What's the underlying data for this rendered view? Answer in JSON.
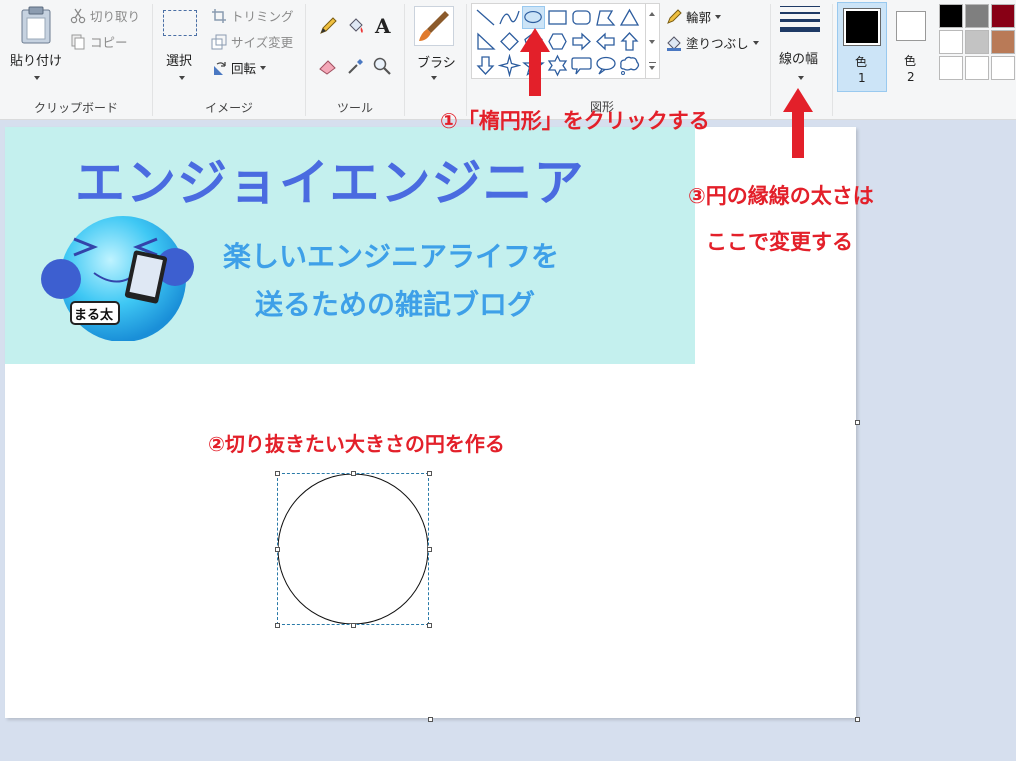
{
  "ribbon": {
    "clipboard": {
      "paste_label": "貼り付け",
      "cut_label": "切り取り",
      "copy_label": "コピー",
      "group_label": "クリップボード"
    },
    "image": {
      "select_label": "選択",
      "crop_label": "トリミング",
      "resize_label": "サイズ変更",
      "rotate_label": "回転",
      "group_label": "イメージ"
    },
    "tools": {
      "group_label": "ツール"
    },
    "brush": {
      "label": "ブラシ"
    },
    "shapes": {
      "outline_label": "輪郭",
      "fill_label": "塗りつぶし",
      "group_label": "図形",
      "selected": "oval-shape",
      "items": [
        "line",
        "curve",
        "oval",
        "rectangle",
        "rounded-rectangle",
        "polygon",
        "triangle",
        "right-triangle",
        "diamond",
        "pentagon",
        "hexagon",
        "right-arrow",
        "left-arrow",
        "up-arrow",
        "down-arrow",
        "four-point-star",
        "five-point-star",
        "six-point-star",
        "rounded-callout",
        "oval-callout",
        "cloud-callout"
      ]
    },
    "size": {
      "label": "線の幅"
    },
    "colors": {
      "color1_label": "色",
      "color1_num": "1",
      "color2_label": "色",
      "color2_num": "2",
      "color1": "#000000",
      "color2": "#ffffff",
      "palette_row1": [
        "#000000",
        "#7f7f7f",
        "#880015"
      ],
      "palette_row2": [
        "#ffffff",
        "#c3c3c3",
        "#b97a57"
      ],
      "palette_row3": [
        "#ffffff",
        "#ffffff",
        "#ffffff"
      ]
    }
  },
  "canvas": {
    "banner": {
      "title": "エンジョイエンジニア",
      "subtitle_line1": "楽しいエンジニアライフを",
      "subtitle_line2": "送るための雑記ブログ",
      "mascot_tag": "まる太"
    }
  },
  "annotations": {
    "step1": "①「楕円形」をクリックする",
    "step2": "②切り抜きたい大きさの円を作る",
    "step3_line1": "③円の縁線の太さは",
    "step3_line2": "ここで変更する"
  },
  "accent_red": "#e3202a"
}
